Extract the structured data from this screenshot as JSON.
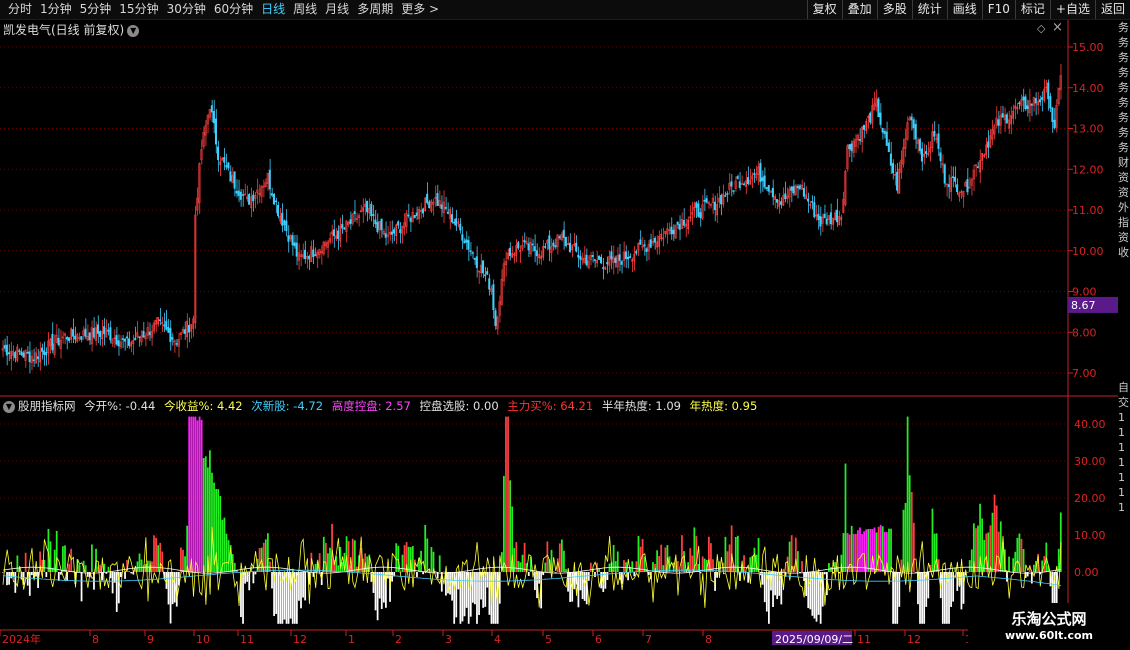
{
  "toolbar": {
    "periods": [
      "分时",
      "1分钟",
      "5分钟",
      "15分钟",
      "30分钟",
      "60分钟",
      "日线",
      "周线",
      "月线",
      "多周期",
      "更多 >"
    ],
    "active": "日线",
    "buttons": [
      "复权",
      "叠加",
      "多股",
      "统计",
      "画线",
      "F10",
      "标记",
      "+自选",
      "返回"
    ]
  },
  "main": {
    "title": "凯发电气(日线 前复权)",
    "price_label": "8.67"
  },
  "indicator": {
    "name": "股朋指标网",
    "items": [
      {
        "label": "今开%:",
        "value": "-0.44",
        "color": "#e0e0e0"
      },
      {
        "label": "今收益%:",
        "value": "4.42",
        "color": "#ffff4d"
      },
      {
        "label": "次新股:",
        "value": "-4.72",
        "color": "#3fd0ff"
      },
      {
        "label": "高度控盘:",
        "value": "2.57",
        "color": "#ff44ff"
      },
      {
        "label": "控盘选股:",
        "value": "0.00",
        "color": "#e0e0e0"
      },
      {
        "label": "主力买%:",
        "value": "64.21",
        "color": "#ff3333"
      },
      {
        "label": "半年热度:",
        "value": "1.09",
        "color": "#e0e0e0"
      },
      {
        "label": "年热度:",
        "value": "0.95",
        "color": "#ffff4d"
      }
    ]
  },
  "watermark": {
    "name": "乐淘公式网",
    "url": "www.60lt.com"
  },
  "colors": {
    "up": "#ff4040",
    "down": "#3fd0ff",
    "grid": "#6a0000",
    "axis": "#cc2222",
    "green": "#22ee22",
    "magenta": "#ff22ff",
    "yellow": "#ffff33"
  },
  "chart_data": {
    "type": "candlestick",
    "price_axis": {
      "ticks": [
        15,
        14,
        13,
        12,
        11,
        10,
        9,
        8,
        7
      ],
      "labels": [
        "15.00",
        "14.00",
        "13.00",
        "12.00",
        "11.00",
        "10.00",
        "9.00",
        "8.00",
        "7.00"
      ]
    },
    "indicator_axis": {
      "ticks": [
        40,
        30,
        20,
        10,
        0
      ],
      "labels": [
        "40.00",
        "30.00",
        "20.00",
        "10.00",
        "0.00"
      ]
    },
    "x_axis": {
      "labels": [
        "2024年",
        "8",
        "9",
        "10",
        "11",
        "12",
        "1",
        "2",
        "3",
        "4",
        "5",
        "6",
        "7",
        "8",
        "2025/09/09/二",
        "11",
        "12",
        "1"
      ]
    },
    "close_anchors": [
      [
        0,
        7.6
      ],
      [
        15,
        7.4
      ],
      [
        30,
        7.9
      ],
      [
        50,
        8.0
      ],
      [
        60,
        7.7
      ],
      [
        75,
        8.2
      ],
      [
        84,
        7.8
      ],
      [
        92,
        8.3
      ],
      [
        93,
        10.9
      ],
      [
        96,
        12.5
      ],
      [
        100,
        13.6
      ],
      [
        104,
        12.4
      ],
      [
        110,
        11.8
      ],
      [
        118,
        11.2
      ],
      [
        128,
        11.8
      ],
      [
        133,
        11.0
      ],
      [
        143,
        9.8
      ],
      [
        150,
        10.0
      ],
      [
        164,
        10.5
      ],
      [
        175,
        11.0
      ],
      [
        186,
        10.3
      ],
      [
        196,
        10.8
      ],
      [
        208,
        11.3
      ],
      [
        216,
        10.9
      ],
      [
        222,
        10.4
      ],
      [
        236,
        9.1
      ],
      [
        238,
        8.2
      ],
      [
        243,
        9.9
      ],
      [
        250,
        10.1
      ],
      [
        260,
        10.0
      ],
      [
        270,
        10.3
      ],
      [
        280,
        9.8
      ],
      [
        295,
        9.7
      ],
      [
        310,
        10.1
      ],
      [
        330,
        10.8
      ],
      [
        345,
        11.2
      ],
      [
        355,
        11.7
      ],
      [
        365,
        11.9
      ],
      [
        376,
        11.2
      ],
      [
        385,
        11.6
      ],
      [
        395,
        10.7
      ],
      [
        405,
        10.9
      ],
      [
        408,
        12.5
      ],
      [
        416,
        13.0
      ],
      [
        422,
        13.6
      ],
      [
        428,
        12.3
      ],
      [
        432,
        11.6
      ],
      [
        438,
        13.4
      ],
      [
        445,
        12.2
      ],
      [
        450,
        12.9
      ],
      [
        455,
        11.8
      ],
      [
        465,
        11.5
      ],
      [
        472,
        12.3
      ],
      [
        480,
        13.1
      ],
      [
        490,
        13.5
      ],
      [
        500,
        13.7
      ],
      [
        505,
        13.9
      ],
      [
        508,
        12.9
      ],
      [
        511,
        14.4
      ]
    ]
  }
}
